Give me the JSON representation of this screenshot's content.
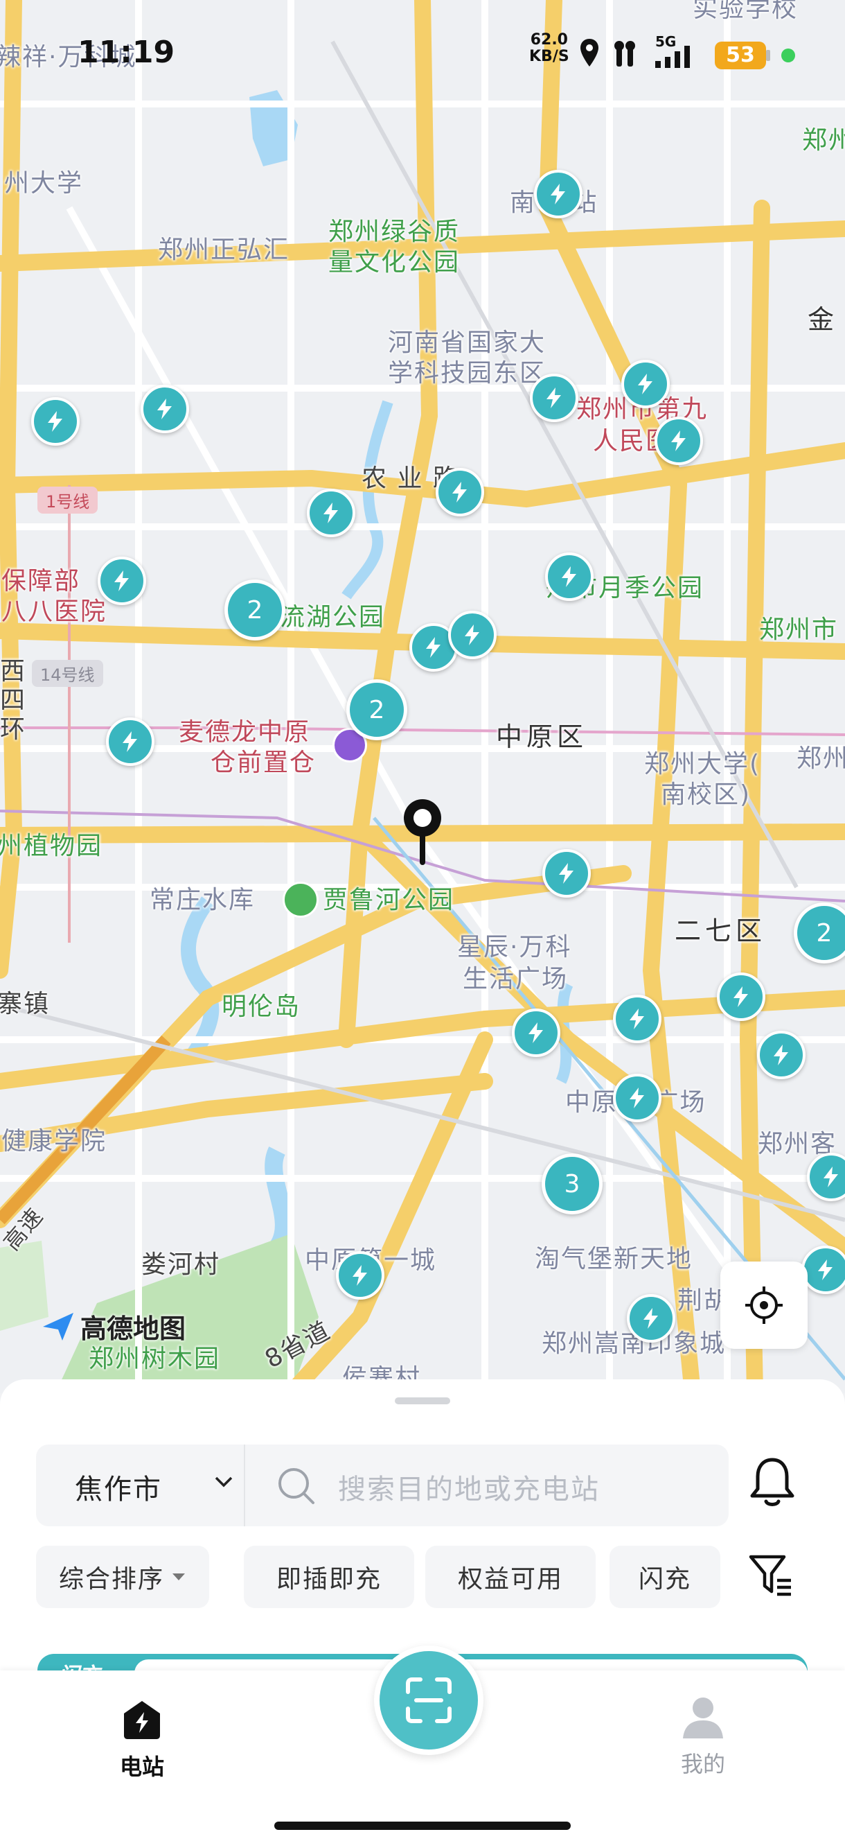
{
  "status_bar": {
    "time": "11:19",
    "net_speed_value": "62.0",
    "net_speed_unit": "KB/S",
    "network": "5G",
    "battery": "53"
  },
  "map": {
    "logo_text": "高德地图",
    "labels": {
      "school": "实验学校",
      "wanke_top": "辣祥·万科城",
      "zhengzhou_univ": "州大学",
      "zhengzhou_right_top": "郑州",
      "nanzhai": "南 寨站",
      "lvgu": "郑州绿谷质",
      "lvgu2": "量文化公园",
      "zhenghong": "郑州正弘汇",
      "jin": "金",
      "keji": "河南省国家大",
      "keji2": "学科技园东区",
      "ninth_hosp": "郑州市第九",
      "ninth_hosp2": "人民医院",
      "line1": "1号线",
      "nongye": "农 业    路",
      "baozhang": "保障部",
      "hosp88": "八八医院",
      "yueji": "州市月季公园",
      "zhengzhou_shi": "郑州市",
      "liuhu": "流湖公园",
      "line14": "14号线",
      "xisihuan": "西四环",
      "mdl": "麦德龙中原",
      "mdl2": "仓前置仓",
      "zhongyuan_qu": "中原区",
      "zzu_south": "郑州大学(",
      "zzu_south2": "南校区)",
      "zhengzhou_r2": "郑州",
      "zhiwuyuan": "州植物园",
      "changzhuang": "常庄水库",
      "jialuhe": "贾鲁河公园",
      "erqi_qu": "二七区",
      "xingchen": "星辰·万科",
      "xingchen2": "生活广场",
      "zhai_zhen": "寨镇",
      "minglun": "明伦岛",
      "zhongyuan_bx": "中原    姓广场",
      "zhengzhou_ke": "郑州客",
      "jiankang": "健康学院",
      "gaosu": "高速",
      "louhe": "娄河村",
      "zhongyuan_first": "中原第一城",
      "taoqibao": "淘气堡新天地",
      "jinghu": "荆胡",
      "shumuyuan": "郑州树木园",
      "sheng8": "8省道",
      "songnan": "郑州嵩南印象城",
      "houzhai": "侯寨村"
    },
    "clusters": [
      "2",
      "2",
      "2",
      "3"
    ]
  },
  "sheet": {
    "city": "焦作市",
    "search_placeholder": "搜索目的地或充电站",
    "chips": [
      "综合排序",
      "即插即充",
      "权益可用",
      "闪充"
    ],
    "strip_label": "闪充"
  },
  "tabbar": {
    "stations": "电站",
    "mine": "我的"
  },
  "colors": {
    "accent": "#3ab6bf",
    "road": "#f5cf6a",
    "water": "#a9d8f5",
    "park": "#bfe3b6"
  }
}
